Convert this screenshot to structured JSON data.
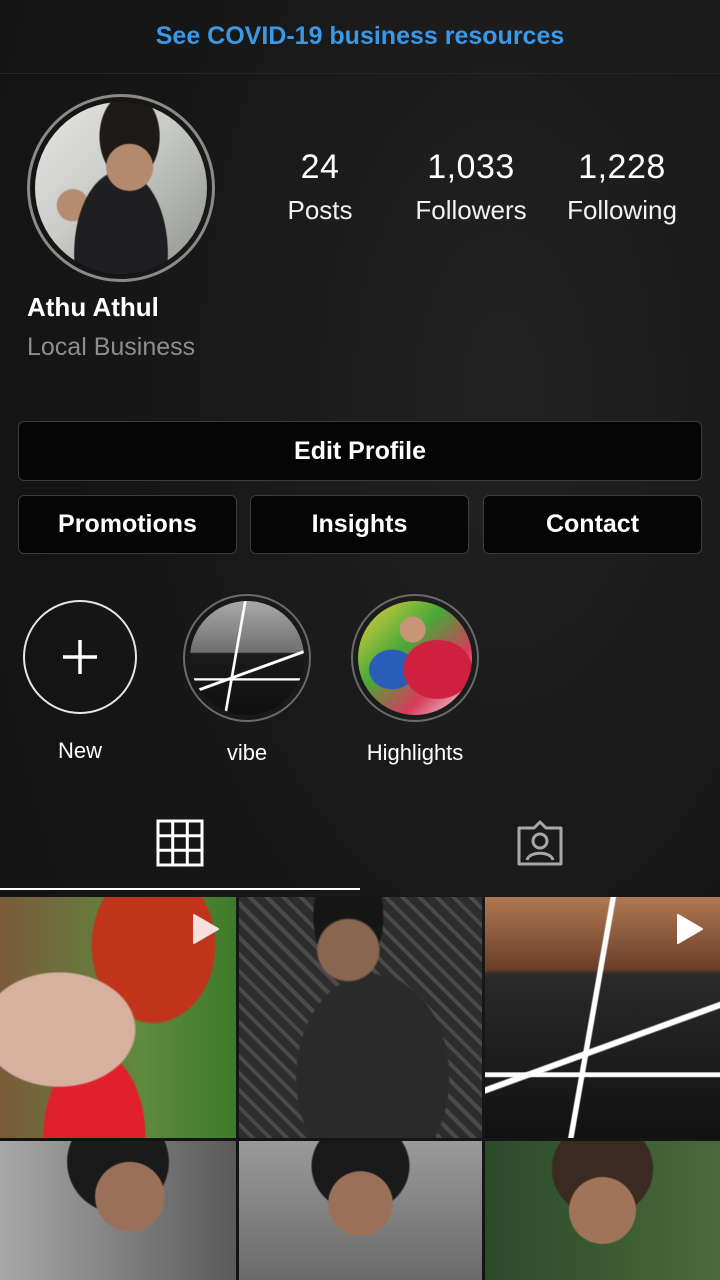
{
  "banner": {
    "text": "See COVID-19 business resources"
  },
  "profile": {
    "stats": [
      {
        "value": "24",
        "label": "Posts"
      },
      {
        "value": "1,033",
        "label": "Followers"
      },
      {
        "value": "1,228",
        "label": "Following"
      }
    ],
    "name": "Athu Athul",
    "category": "Local Business"
  },
  "buttons": {
    "edit_profile": "Edit Profile",
    "promotions": "Promotions",
    "insights": "Insights",
    "contact": "Contact"
  },
  "highlights": [
    {
      "label": "New",
      "icon": "plus-icon"
    },
    {
      "label": "vibe"
    },
    {
      "label": "Highlights"
    }
  ],
  "tabs": [
    {
      "icon": "grid-icon",
      "active": true
    },
    {
      "icon": "tagged-person-icon",
      "active": false
    }
  ],
  "posts": [
    {
      "video": true
    },
    {
      "video": false
    },
    {
      "video": true
    },
    {
      "video": false
    },
    {
      "video": false
    },
    {
      "video": false
    }
  ],
  "colors": {
    "background": "#141414",
    "link_blue": "#3a98e8",
    "secondary_text": "#8e8e8e",
    "button_border": "#3b3b3b"
  }
}
